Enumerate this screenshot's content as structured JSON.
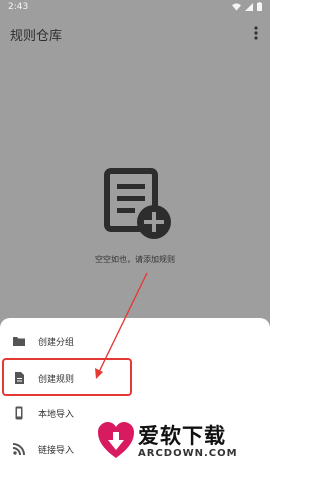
{
  "status_bar": {
    "time": "2:43"
  },
  "app_bar": {
    "title": "规则仓库"
  },
  "empty_state": {
    "message": "空空如也，请添加规则"
  },
  "bottom_sheet": {
    "items": [
      {
        "label": "创建分组",
        "icon": "folder-icon"
      },
      {
        "label": "创建规则",
        "icon": "document-icon"
      },
      {
        "label": "本地导入",
        "icon": "phone-icon"
      },
      {
        "label": "链接导入",
        "icon": "rss-icon"
      }
    ]
  },
  "watermark": {
    "title": "爱软下载",
    "subtitle": "ARCDOWN.COM"
  },
  "colors": {
    "highlight": "#e53935",
    "overlay": "#9e9e9e"
  }
}
